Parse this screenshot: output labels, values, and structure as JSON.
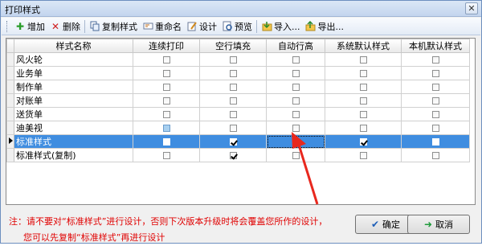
{
  "window": {
    "title": "打印样式",
    "close_label": "✕"
  },
  "toolbar": {
    "items": [
      {
        "label": "增加",
        "icon": "add-icon"
      },
      {
        "label": "删除",
        "icon": "delete-icon"
      },
      {
        "label": "复制样式",
        "icon": "copy-icon"
      },
      {
        "label": "重命名",
        "icon": "rename-icon"
      },
      {
        "label": "设计",
        "icon": "design-icon"
      },
      {
        "label": "预览",
        "icon": "preview-icon"
      },
      {
        "label": "导入...",
        "icon": "import-icon"
      },
      {
        "label": "导出...",
        "icon": "export-icon"
      }
    ]
  },
  "grid": {
    "columns": [
      "样式名称",
      "连续打印",
      "空行填充",
      "自动行高",
      "系统默认样式",
      "本机默认样式"
    ],
    "rows": [
      {
        "name": "风火轮",
        "flags": [
          false,
          false,
          false,
          false,
          false
        ],
        "selected": false
      },
      {
        "name": "业务单",
        "flags": [
          false,
          false,
          false,
          false,
          false
        ],
        "selected": false
      },
      {
        "name": "制作单",
        "flags": [
          false,
          false,
          false,
          false,
          false
        ],
        "selected": false
      },
      {
        "name": "对账单",
        "flags": [
          false,
          false,
          false,
          false,
          false
        ],
        "selected": false
      },
      {
        "name": "送货单",
        "flags": [
          false,
          false,
          false,
          false,
          false
        ],
        "selected": false
      },
      {
        "name": "迪美视",
        "flags": [
          false,
          false,
          false,
          false,
          false
        ],
        "selected": false
      },
      {
        "name": "标准样式",
        "flags": [
          false,
          true,
          true,
          true,
          false
        ],
        "selected": true
      },
      {
        "name": "标准样式(复制)",
        "flags": [
          false,
          true,
          false,
          false,
          false
        ],
        "selected": false
      }
    ]
  },
  "notice": {
    "line1": "注：请不要对“标准样式”进行设计，否则下次版本升级时将会覆盖您所作的设计，",
    "line2": "您可以先复制“标准样式”再进行设计"
  },
  "buttons": {
    "ok": "确定",
    "cancel": "取消"
  },
  "colors": {
    "selected_row": "#3f8de0",
    "notice": "#e00000",
    "arrow": "#e8281e"
  }
}
